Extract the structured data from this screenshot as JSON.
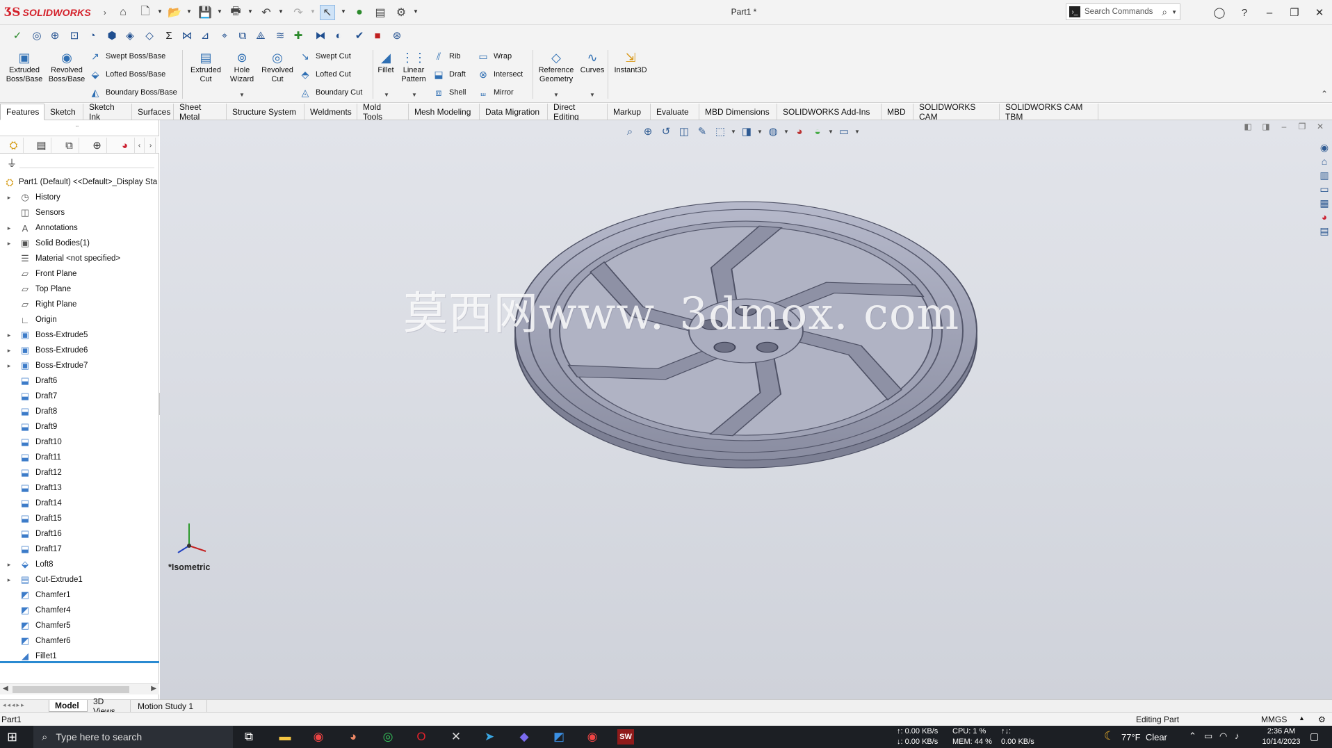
{
  "app": {
    "logo_text": "SOLIDWORKS",
    "document_title": "Part1 *",
    "search_placeholder": "Search Commands"
  },
  "ribbon": {
    "extruded_boss": "Extruded\nBoss/Base",
    "revolved_boss": "Revolved\nBoss/Base",
    "swept_boss": "Swept Boss/Base",
    "lofted_boss": "Lofted Boss/Base",
    "boundary_boss": "Boundary Boss/Base",
    "extruded_cut": "Extruded\nCut",
    "hole_wizard": "Hole\nWizard",
    "revolved_cut": "Revolved\nCut",
    "swept_cut": "Swept Cut",
    "lofted_cut": "Lofted Cut",
    "boundary_cut": "Boundary Cut",
    "fillet": "Fillet",
    "linear_pattern": "Linear\nPattern",
    "rib": "Rib",
    "draft": "Draft",
    "shell": "Shell",
    "wrap": "Wrap",
    "intersect": "Intersect",
    "mirror": "Mirror",
    "reference_geometry": "Reference\nGeometry",
    "curves": "Curves",
    "instant3d": "Instant3D"
  },
  "tabs": [
    "Features",
    "Sketch",
    "Sketch Ink",
    "Surfaces",
    "Sheet Metal",
    "Structure System",
    "Weldments",
    "Mold Tools",
    "Mesh Modeling",
    "Data Migration",
    "Direct Editing",
    "Markup",
    "Evaluate",
    "MBD Dimensions",
    "SOLIDWORKS Add-Ins",
    "MBD",
    "SOLIDWORKS CAM",
    "SOLIDWORKS CAM TBM"
  ],
  "active_tab": "Features",
  "tree": {
    "root": "Part1 (Default) <<Default>_Display Sta",
    "items": [
      {
        "label": "History",
        "icon": "history-icon"
      },
      {
        "label": "Sensors",
        "icon": "sensor-icon"
      },
      {
        "label": "Annotations",
        "icon": "annotation-icon"
      },
      {
        "label": "Solid Bodies(1)",
        "icon": "solid-bodies-icon"
      },
      {
        "label": "Material <not specified>",
        "icon": "material-icon"
      },
      {
        "label": "Front Plane",
        "icon": "plane-icon"
      },
      {
        "label": "Top Plane",
        "icon": "plane-icon"
      },
      {
        "label": "Right Plane",
        "icon": "plane-icon"
      },
      {
        "label": "Origin",
        "icon": "origin-icon"
      },
      {
        "label": "Boss-Extrude5",
        "icon": "extrude-icon"
      },
      {
        "label": "Boss-Extrude6",
        "icon": "extrude-icon"
      },
      {
        "label": "Boss-Extrude7",
        "icon": "extrude-icon"
      },
      {
        "label": "Draft6",
        "icon": "draft-icon"
      },
      {
        "label": "Draft7",
        "icon": "draft-icon"
      },
      {
        "label": "Draft8",
        "icon": "draft-icon"
      },
      {
        "label": "Draft9",
        "icon": "draft-icon"
      },
      {
        "label": "Draft10",
        "icon": "draft-icon"
      },
      {
        "label": "Draft11",
        "icon": "draft-icon"
      },
      {
        "label": "Draft12",
        "icon": "draft-icon"
      },
      {
        "label": "Draft13",
        "icon": "draft-icon"
      },
      {
        "label": "Draft14",
        "icon": "draft-icon"
      },
      {
        "label": "Draft15",
        "icon": "draft-icon"
      },
      {
        "label": "Draft16",
        "icon": "draft-icon"
      },
      {
        "label": "Draft17",
        "icon": "draft-icon"
      },
      {
        "label": "Loft8",
        "icon": "loft-icon"
      },
      {
        "label": "Cut-Extrude1",
        "icon": "cut-extrude-icon"
      },
      {
        "label": "Chamfer1",
        "icon": "chamfer-icon"
      },
      {
        "label": "Chamfer4",
        "icon": "chamfer-icon"
      },
      {
        "label": "Chamfer5",
        "icon": "chamfer-icon"
      },
      {
        "label": "Chamfer6",
        "icon": "chamfer-icon"
      },
      {
        "label": "Fillet1",
        "icon": "fillet-icon"
      }
    ]
  },
  "viewport": {
    "view_label": "*Isometric",
    "watermark": "莫西网www. 3dmox. com"
  },
  "bottom_tabs": [
    "Model",
    "3D Views",
    "Motion Study 1"
  ],
  "status": {
    "left": "Part1",
    "mode": "Editing Part",
    "units": "MMGS"
  },
  "taskbar": {
    "search_placeholder": "Type here to search",
    "net_up": "↑: 0.00 KB/s",
    "net_down": "↓: 0.00 KB/s",
    "cpu": "CPU: 1 %",
    "mem": "MEM: 44 %",
    "disk_label": "↑↓:",
    "disk_rate": "0.00 KB/s",
    "weather": "77°F  Clear",
    "time": "2:36 AM",
    "date": "10/14/2023"
  },
  "colors": {
    "accent": "#d4202a",
    "active_blue": "#2a8ad1",
    "model_fill": "#a4a7b9"
  }
}
